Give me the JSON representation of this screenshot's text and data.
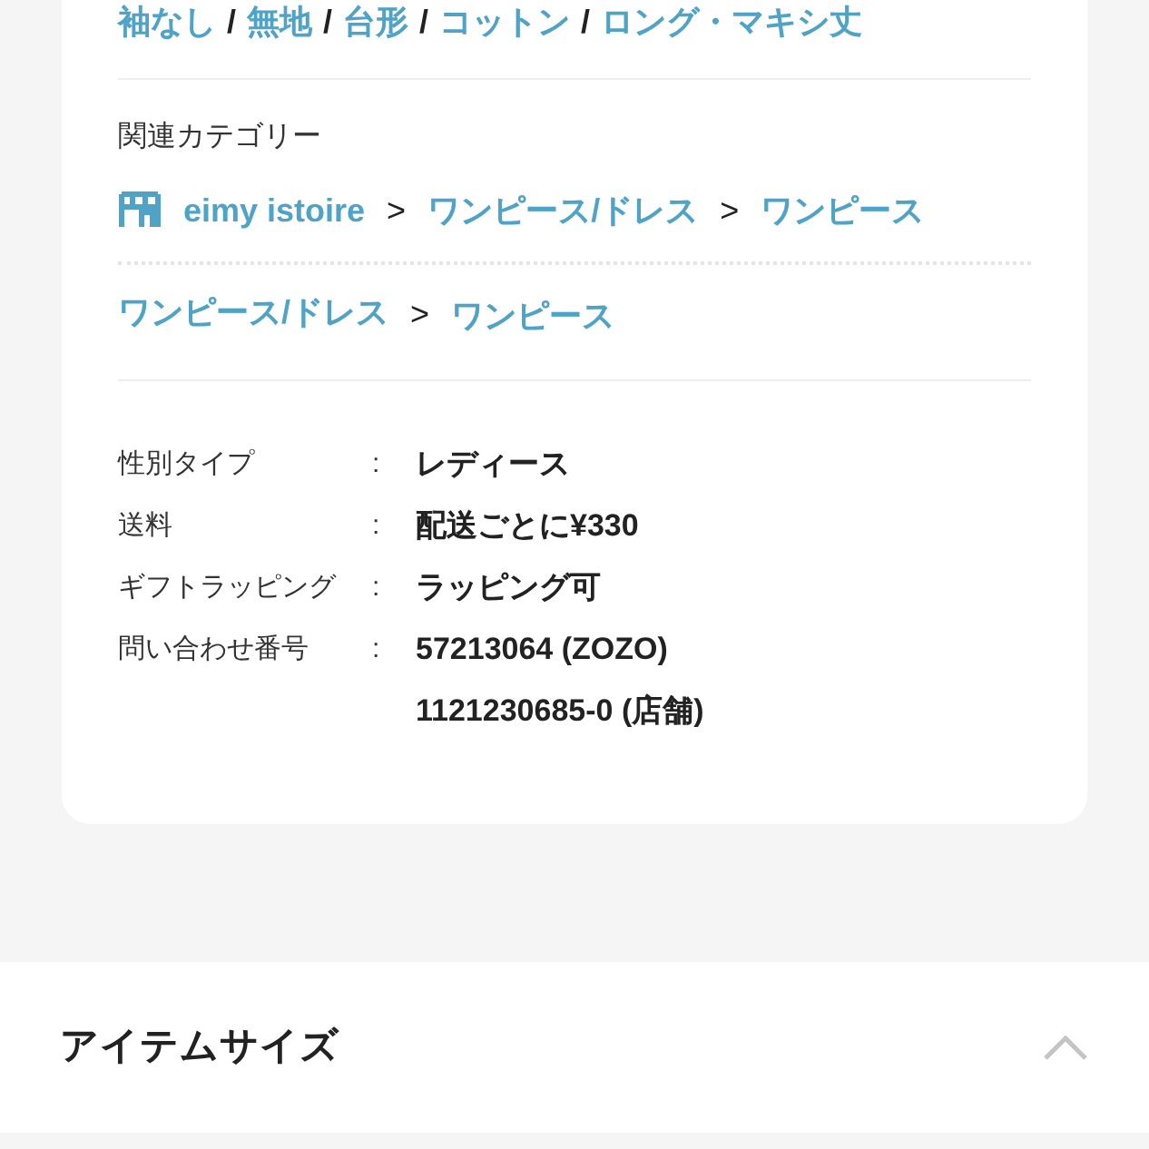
{
  "tags": [
    {
      "label": "袖なし"
    },
    {
      "separator": "/",
      "label": "無地"
    },
    {
      "separator": "/",
      "label": "台形"
    },
    {
      "separator": "/",
      "label": "コットン"
    },
    {
      "separator": "/",
      "label": "ロング・マキシ丈"
    }
  ],
  "related_categories": {
    "heading": "関連カテゴリー",
    "paths": [
      {
        "items": [
          {
            "kind": "shop",
            "label": "eimy istoire"
          },
          {
            "kind": "category",
            "separator": ">",
            "label": "ワンピース/ドレス"
          },
          {
            "kind": "category",
            "separator": ">",
            "label": "ワンピース"
          }
        ]
      },
      {
        "items": [
          {
            "kind": "category",
            "label": "ワンピース/ドレス"
          },
          {
            "kind": "category",
            "separator": ">",
            "label": "ワンピース"
          }
        ]
      }
    ]
  },
  "specs": [
    {
      "label": "性別タイプ",
      "colon": ":",
      "values": [
        "レディース"
      ]
    },
    {
      "label": "送料",
      "colon": ":",
      "values": [
        "配送ごとに¥330"
      ]
    },
    {
      "label": "ギフトラッピング",
      "colon": ":",
      "values": [
        "ラッピング可"
      ]
    },
    {
      "label": "問い合わせ番号",
      "colon": ":",
      "values": [
        "57213064 (ZOZO)",
        "1121230685-0 (店舗)"
      ]
    }
  ],
  "item_size_section": {
    "title": "アイテムサイズ",
    "expanded": true
  }
}
